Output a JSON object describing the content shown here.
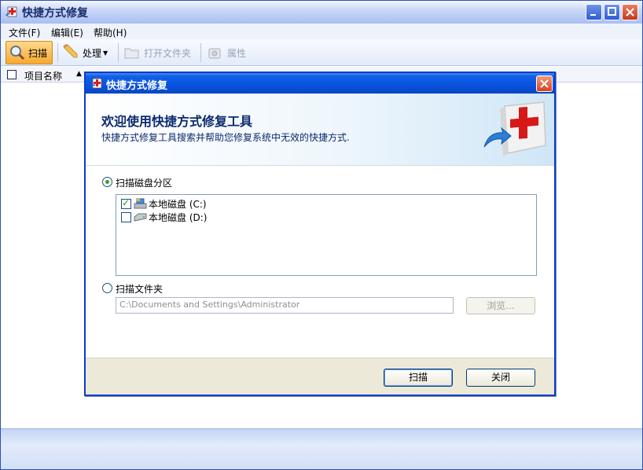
{
  "window": {
    "title": "快捷方式修复"
  },
  "menu": {
    "file": "文件(F)",
    "edit": "编辑(E)",
    "help": "帮助(H)"
  },
  "toolbar": {
    "scan": "扫描",
    "process": "处理",
    "open_folder": "打开文件夹",
    "properties": "属性"
  },
  "list": {
    "col_name": "项目名称"
  },
  "dialog": {
    "title": "快捷方式修复",
    "heading": "欢迎使用快捷方式修复工具",
    "subheading": "快捷方式修复工具搜索并帮助您修复系统中无效的快捷方式.",
    "option_partitions": "扫描磁盘分区",
    "option_folder": "扫描文件夹",
    "drives": [
      {
        "label": "本地磁盘 (C:)",
        "checked": true
      },
      {
        "label": "本地磁盘 (D:)",
        "checked": false
      }
    ],
    "folder_path": "C:\\Documents and Settings\\Administrator",
    "browse": "浏览...",
    "scan_button": "扫描",
    "close_button": "关闭"
  },
  "colors": {
    "dialog_title": "#0953df",
    "accent_red": "#d81e1e",
    "toolbar_active": "#f7a833"
  }
}
